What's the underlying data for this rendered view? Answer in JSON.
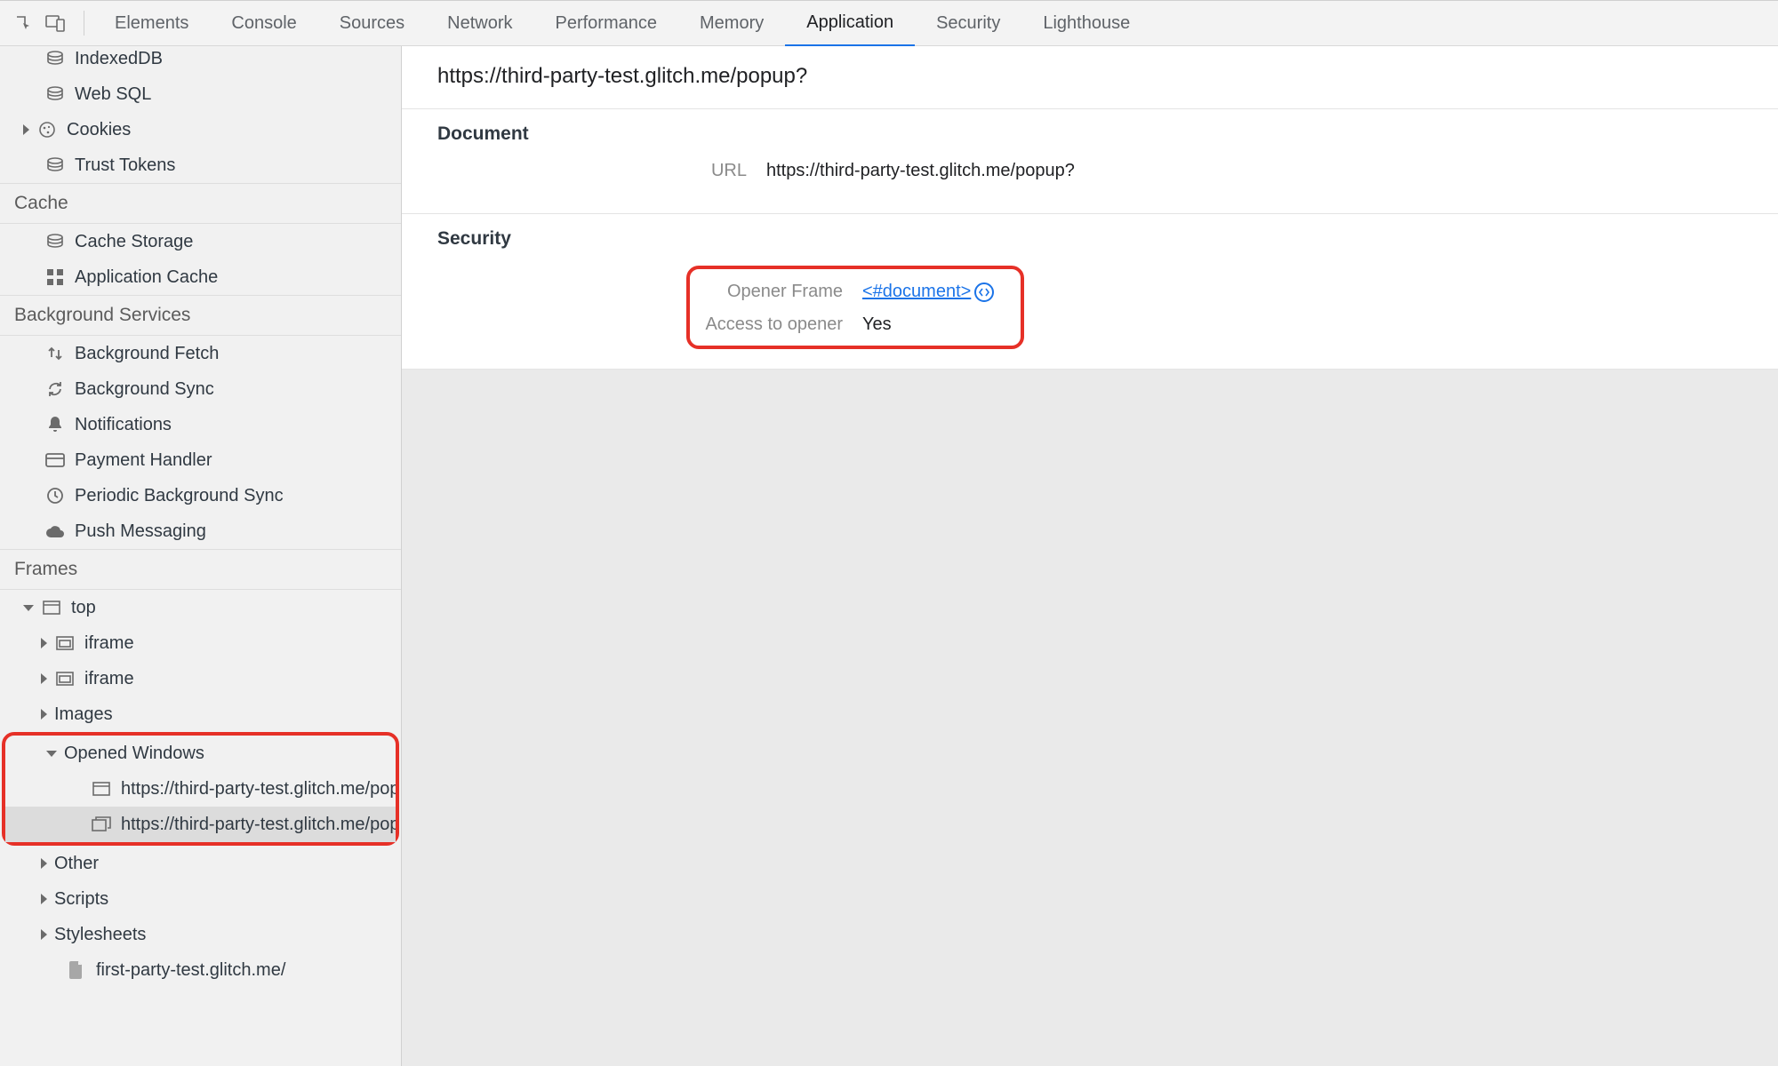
{
  "tabs": {
    "elements": "Elements",
    "console": "Console",
    "sources": "Sources",
    "network": "Network",
    "performance": "Performance",
    "memory": "Memory",
    "application": "Application",
    "security": "Security",
    "lighthouse": "Lighthouse"
  },
  "sidebar": {
    "storage": {
      "indexeddb": "IndexedDB",
      "websql": "Web SQL",
      "cookies": "Cookies",
      "trust_tokens": "Trust Tokens"
    },
    "cache_heading": "Cache",
    "cache": {
      "cache_storage": "Cache Storage",
      "app_cache": "Application Cache"
    },
    "bg_heading": "Background Services",
    "bg": {
      "fetch": "Background Fetch",
      "sync": "Background Sync",
      "notifications": "Notifications",
      "payment": "Payment Handler",
      "periodic": "Periodic Background Sync",
      "push": "Push Messaging"
    },
    "frames_heading": "Frames",
    "frames": {
      "top": "top",
      "iframe1": "iframe",
      "iframe2": "iframe",
      "images": "Images",
      "opened_windows": "Opened Windows",
      "ow1": "https://third-party-test.glitch.me/popup?",
      "ow2": "https://third-party-test.glitch.me/popup?",
      "other": "Other",
      "scripts": "Scripts",
      "stylesheets": "Stylesheets",
      "file1": "first-party-test.glitch.me/"
    }
  },
  "main": {
    "title": "https://third-party-test.glitch.me/popup?",
    "doc_heading": "Document",
    "url_label": "URL",
    "url_value": "https://third-party-test.glitch.me/popup?",
    "sec_heading": "Security",
    "opener_frame_label": "Opener Frame",
    "opener_frame_value": "<#document>",
    "access_label": "Access to opener",
    "access_value": "Yes"
  }
}
